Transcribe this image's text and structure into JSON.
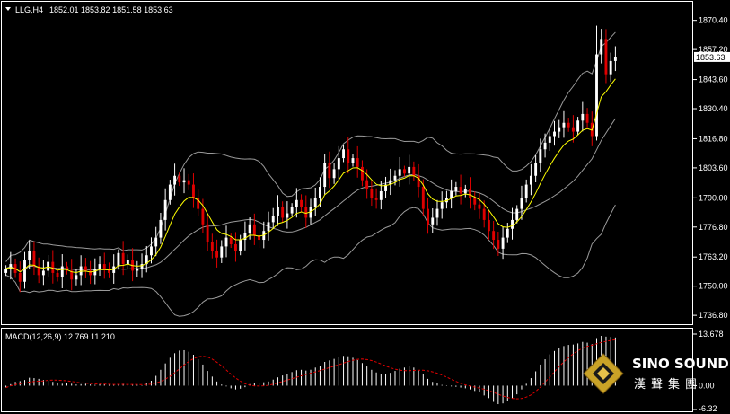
{
  "header": {
    "symbol": "LLG,H4",
    "ohlc": "1852.01 1853.82 1851.58 1853.63"
  },
  "macd_header": {
    "label": "MACD(12,26,9) 12.769 11.210"
  },
  "price_axis": {
    "ticks": [
      "1870.40",
      "1857.20",
      "1843.60",
      "1830.40",
      "1816.80",
      "1803.60",
      "1790.00",
      "1776.80",
      "1763.20",
      "1750.00",
      "1736.80"
    ],
    "current_price": "1853.63"
  },
  "macd_axis": {
    "ticks": [
      "13.678",
      "0.00",
      "-6.32"
    ]
  },
  "logo": {
    "en": "SINO SOUND",
    "cn": "漢聲集團"
  },
  "colors": {
    "up": "#ffffff",
    "down": "#e00000",
    "bollinger": "#9a9a9a",
    "ma": "#ffff00",
    "signal": "#e00000",
    "grid": "#ffffff"
  },
  "chart_data": [
    {
      "type": "candlestick",
      "title": "LLG,H4",
      "ylim": [
        1734,
        1878
      ],
      "indicators": [
        "Bollinger Bands",
        "Moving Average"
      ],
      "close": [
        1758,
        1760,
        1756,
        1752,
        1762,
        1766,
        1759,
        1755,
        1757,
        1761,
        1756,
        1754,
        1759,
        1757,
        1753,
        1755,
        1759,
        1757,
        1755,
        1758,
        1760,
        1758,
        1756,
        1759,
        1765,
        1760,
        1762,
        1757,
        1758,
        1760,
        1764,
        1768,
        1772,
        1780,
        1789,
        1796,
        1800,
        1797,
        1798,
        1796,
        1790,
        1785,
        1778,
        1770,
        1766,
        1763,
        1768,
        1772,
        1769,
        1766,
        1771,
        1774,
        1778,
        1773,
        1771,
        1775,
        1779,
        1782,
        1786,
        1781,
        1783,
        1786,
        1789,
        1786,
        1781,
        1786,
        1790,
        1795,
        1806,
        1799,
        1803,
        1808,
        1812,
        1806,
        1808,
        1804,
        1798,
        1794,
        1790,
        1789,
        1793,
        1796,
        1798,
        1800,
        1803,
        1801,
        1804,
        1800,
        1795,
        1785,
        1778,
        1781,
        1785,
        1788,
        1790,
        1793,
        1795,
        1792,
        1794,
        1790,
        1787,
        1785,
        1780,
        1775,
        1771,
        1767,
        1772,
        1776,
        1780,
        1785,
        1790,
        1796,
        1800,
        1806,
        1812,
        1815,
        1818,
        1820,
        1822,
        1824,
        1822,
        1820,
        1825,
        1828,
        1824,
        1818,
        1855,
        1862,
        1846,
        1852,
        1853.63
      ]
    },
    {
      "type": "bar",
      "title": "MACD(12,26,9) 12.769 11.210",
      "ylim": [
        -6.32,
        13.678
      ],
      "values": [
        -0.5,
        0.4,
        1.0,
        1.2,
        1.5,
        2.1,
        2.0,
        1.8,
        1.5,
        1.3,
        1.0,
        0.6,
        0.5,
        0.7,
        0.5,
        0.3,
        0.4,
        0.5,
        0.3,
        0.2,
        0.5,
        0.4,
        0.2,
        0.2,
        0.4,
        0.5,
        0.3,
        0.2,
        0.2,
        0.1,
        0.6,
        1.3,
        2.6,
        4.2,
        5.9,
        7.4,
        8.6,
        9.3,
        9.4,
        9.0,
        8.2,
        7.0,
        5.6,
        3.9,
        2.4,
        1.1,
        0.3,
        -0.2,
        -0.7,
        -1.0,
        -0.8,
        -0.4,
        0.4,
        0.7,
        0.8,
        0.9,
        1.1,
        1.6,
        2.2,
        2.7,
        3.1,
        3.6,
        4.1,
        4.2,
        4.0,
        4.2,
        4.8,
        5.3,
        6.3,
        6.7,
        7.1,
        7.5,
        7.9,
        7.8,
        7.4,
        6.8,
        6.0,
        5.1,
        4.2,
        3.5,
        3.2,
        3.2,
        3.4,
        3.9,
        4.5,
        4.8,
        5.1,
        4.8,
        4.1,
        3.0,
        1.8,
        1.0,
        0.6,
        0.2,
        -0.1,
        -0.2,
        -0.3,
        -0.5,
        -0.7,
        -1.0,
        -1.4,
        -1.8,
        -2.6,
        -3.3,
        -4.3,
        -4.9,
        -4.7,
        -4.1,
        -3.3,
        -2.3,
        -1.0,
        0.5,
        2.0,
        3.8,
        5.6,
        7.0,
        8.3,
        9.2,
        9.9,
        10.5,
        10.8,
        10.9,
        11.2,
        11.6,
        11.4,
        11.0,
        12.6,
        13.2,
        13.0,
        12.9,
        12.769
      ],
      "signal_value": 11.21
    }
  ]
}
